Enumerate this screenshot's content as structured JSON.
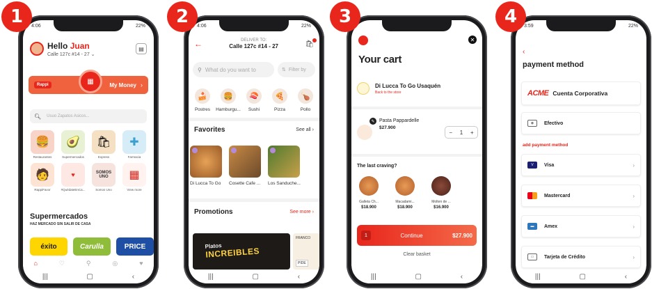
{
  "badges": [
    "1",
    "2",
    "3",
    "4"
  ],
  "phone1": {
    "time": "4:06",
    "battery": "22%",
    "hello": "Hello",
    "name": "Juan",
    "address": "Calle 127c #14 - 27",
    "money_label": "My Money",
    "search_placeholder": "Usuo Zapatos Asicos...",
    "categories": [
      {
        "label": "Restaurantes",
        "icon": "burger-icon",
        "bg": "#f8d3c8"
      },
      {
        "label": "Supermercados",
        "icon": "avocado-icon",
        "bg": "#e8f1d4"
      },
      {
        "label": "Express",
        "icon": "bag-icon",
        "bg": "#f6e0c4"
      },
      {
        "label": "Farmacia",
        "icon": "medkit-icon",
        "bg": "#d6ecf6"
      },
      {
        "label": "RappiFavor",
        "icon": "courier-icon",
        "bg": "#fde3d3"
      },
      {
        "label": "#QuédateEnCa...",
        "icon": "promo-icon",
        "bg": "#fde8e3"
      },
      {
        "label": "Somos Uno",
        "icon": "somos-uno-icon",
        "bg": "#f7e3de"
      },
      {
        "label": "View more",
        "icon": "grid-icon",
        "bg": "#fff2ef"
      }
    ],
    "section_title": "Supermercados",
    "section_subtitle": "HAZ MERCADO SIN SALIR DE CASA",
    "stores": [
      {
        "name": "éxito",
        "bg": "#ffd500",
        "color": "#1c1c1c"
      },
      {
        "name": "Carulla",
        "bg": "#8fbd3a",
        "color": "#ffffff"
      },
      {
        "name": "PRICE",
        "bg": "#1f4fa5",
        "color": "#ffffff"
      }
    ]
  },
  "phone2": {
    "time": "4:06",
    "battery": "22%",
    "deliver_label": "DELIVER TO:",
    "address": "Calle 127c #14 - 27",
    "search_placeholder": "What do you want to",
    "filter_label": "Filter by",
    "categories": [
      "Postres",
      "Hamburgu...",
      "Sushi",
      "Pizza",
      "Pollo"
    ],
    "favorites_title": "Favorites",
    "see_all": "See all",
    "favorites": [
      "Di Lucca To Go",
      "Cosette Cafe ...",
      "Los Sanduche..."
    ],
    "promotions_title": "Promotions",
    "see_more": "See more",
    "promo_line1": "Platos",
    "promo_line2": "INCREIBLES",
    "promo2_text": "FRANCO",
    "promo2_btn": "PIDE"
  },
  "phone3": {
    "title": "Your cart",
    "store_name": "Di Lucca To Go Usaquén",
    "back_to_store": "Back to the store",
    "item_name": "Pasta Pappardelle",
    "item_price": "$27.900",
    "qty": "1",
    "craving_title": "The last craving?",
    "cravings": [
      {
        "name": "Galleta Ch...",
        "price": "$18.900"
      },
      {
        "name": "Macadami...",
        "price": "$18.900"
      },
      {
        "name": "Molten de ...",
        "price": "$16.900"
      }
    ],
    "continue_qty": "1",
    "continue_label": "Continue",
    "continue_price": "$27.900",
    "clear_basket": "Clear basket"
  },
  "phone4": {
    "time": "3:59",
    "battery": "22%",
    "title": "payment method",
    "acme": "ACME",
    "corporate": "Cuenta Corporativa",
    "cash": "Efectivo",
    "add_method": "add payment method",
    "methods": [
      {
        "label": "Visa",
        "color": "#1a1f71"
      },
      {
        "label": "Mastercard",
        "color": "#eb001b"
      },
      {
        "label": "Amex",
        "color": "#2e77bb"
      },
      {
        "label": "Tarjeta de Crédito",
        "color": "#666666"
      }
    ]
  }
}
